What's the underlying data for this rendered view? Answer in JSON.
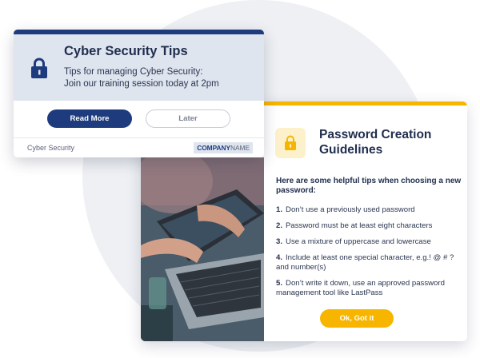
{
  "tips_card": {
    "title": "Cyber Security Tips",
    "message_line1": "Tips for managing Cyber Security:",
    "message_line2": "Join our training session today at 2pm",
    "read_more_label": "Read More",
    "later_label": "Later",
    "category": "Cyber Security",
    "company_strong": "COMPANY",
    "company_light": "NAME",
    "icon": "lock-icon"
  },
  "guidelines": {
    "title_line1": "Password Creation",
    "title_line2": "Guidelines",
    "intro": "Here are some helpful tips when choosing a new password:",
    "tips": [
      {
        "num": "1.",
        "text": "Don’t use a previously used password"
      },
      {
        "num": "2.",
        "text": "Password must be at least eight characters"
      },
      {
        "num": "3.",
        "text": "Use a mixture of uppercase and lowercase"
      },
      {
        "num": "4.",
        "text": "Include at least one special character, e.g.! @ # ?  and number(s)"
      },
      {
        "num": "5.",
        "text": "Don’t write it down, use an approved password management tool like LastPass"
      }
    ],
    "ok_label": "Ok, Got it",
    "icon": "lock-icon"
  },
  "colors": {
    "navy": "#1d3b7d",
    "yellow": "#f7b500",
    "header_bg": "#dfe5ef"
  }
}
